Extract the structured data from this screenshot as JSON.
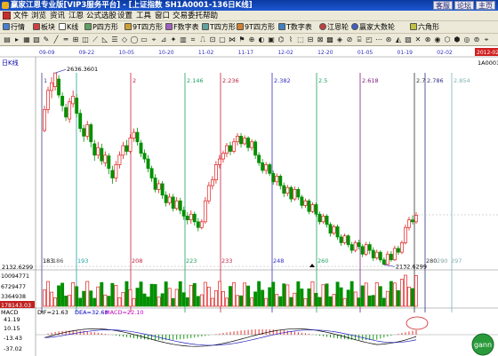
{
  "window": {
    "title": "赢家江恩专业版[VIP3服务平台] - [上证指数  SH1A0001-136日K线]",
    "buttons": [
      "客服",
      "论坛",
      "主页"
    ]
  },
  "menu": [
    "文件",
    "浏览",
    "资讯",
    "江恩",
    "公式选股",
    "设置",
    "工具",
    "窗口",
    "交易委托",
    "帮助"
  ],
  "toolbar1": [
    "行情",
    "板块",
    "K线",
    "P四方形",
    "9T四方形",
    "F数字表",
    "T四方形",
    "9T四方形",
    "T数字表",
    "江恩轮",
    "赢家大数轮",
    "六角形"
  ],
  "chart": {
    "period_label": "日K线",
    "date_ticks": [
      "09-09",
      "09-22",
      "10-05",
      "10-20",
      "11-02",
      "11-17",
      "12-02",
      "12-20",
      "01-05",
      "01-19",
      "02-02",
      "2012-02"
    ],
    "top_right_code": "1A0001",
    "price_top": "2636.3601",
    "price_low": "2132.6299",
    "price_left_low": "2132.6299",
    "cycle_labels": [
      "1",
      "2",
      "2.146",
      "2.236",
      "2.382",
      "2.5",
      "2.618",
      "2.786",
      "2.854",
      "2.7"
    ],
    "bottom_labels": [
      "183",
      "186",
      "193",
      "208",
      "223",
      "233",
      "248",
      "260",
      "280",
      "290",
      "297",
      "27"
    ],
    "volume_labels": [
      "10094771",
      "6729477",
      "3364938",
      "178143.03"
    ],
    "macd_header": {
      "name": "MACD",
      "dif": "DIF=21.63",
      "dea": "DEA=32.68",
      "macd": "MACD=22.10"
    },
    "macd_axis": [
      "41.19",
      "10.15",
      "-13.43",
      "-37.02"
    ],
    "logo_text": "gann"
  },
  "chart_data": {
    "type": "candlestick",
    "title": "上证指数  SH1A0001-136日K线",
    "ylim": [
      2132.6299,
      2636.3601
    ],
    "bars": [
      [
        2485,
        2540,
        2480,
        2550
      ],
      [
        2540,
        2590,
        2530,
        2600
      ],
      [
        2590,
        2610,
        2570,
        2625
      ],
      [
        2600,
        2636,
        2590,
        2636
      ],
      [
        2620,
        2578,
        2570,
        2630
      ],
      [
        2575,
        2550,
        2535,
        2585
      ],
      [
        2545,
        2520,
        2510,
        2555
      ],
      [
        2515,
        2560,
        2505,
        2570
      ],
      [
        2555,
        2575,
        2545,
        2590
      ],
      [
        2570,
        2530,
        2520,
        2580
      ],
      [
        2530,
        2490,
        2480,
        2540
      ],
      [
        2490,
        2470,
        2455,
        2500
      ],
      [
        2470,
        2500,
        2460,
        2510
      ],
      [
        2500,
        2455,
        2440,
        2505
      ],
      [
        2450,
        2420,
        2405,
        2460
      ],
      [
        2420,
        2440,
        2410,
        2455
      ],
      [
        2438,
        2405,
        2395,
        2450
      ],
      [
        2400,
        2420,
        2390,
        2430
      ],
      [
        2418,
        2385,
        2370,
        2425
      ],
      [
        2380,
        2360,
        2345,
        2392
      ],
      [
        2360,
        2395,
        2350,
        2405
      ],
      [
        2395,
        2420,
        2385,
        2430
      ],
      [
        2420,
        2445,
        2410,
        2455
      ],
      [
        2445,
        2430,
        2420,
        2460
      ],
      [
        2430,
        2465,
        2425,
        2475
      ],
      [
        2465,
        2480,
        2455,
        2490
      ],
      [
        2480,
        2455,
        2445,
        2492
      ],
      [
        2452,
        2425,
        2415,
        2460
      ],
      [
        2425,
        2410,
        2400,
        2435
      ],
      [
        2410,
        2385,
        2375,
        2420
      ],
      [
        2385,
        2360,
        2350,
        2392
      ],
      [
        2360,
        2330,
        2322,
        2370
      ],
      [
        2330,
        2345,
        2320,
        2355
      ],
      [
        2345,
        2315,
        2305,
        2352
      ],
      [
        2315,
        2295,
        2285,
        2325
      ],
      [
        2295,
        2310,
        2288,
        2320
      ],
      [
        2310,
        2280,
        2272,
        2318
      ],
      [
        2280,
        2300,
        2275,
        2310
      ],
      [
        2300,
        2275,
        2265,
        2308
      ],
      [
        2275,
        2260,
        2250,
        2285
      ],
      [
        2260,
        2250,
        2238,
        2270
      ],
      [
        2250,
        2265,
        2240,
        2275
      ],
      [
        2265,
        2245,
        2235,
        2272
      ],
      [
        2245,
        2230,
        2220,
        2255
      ],
      [
        2230,
        2245,
        2225,
        2252
      ],
      [
        2245,
        2300,
        2240,
        2310
      ],
      [
        2300,
        2340,
        2292,
        2350
      ],
      [
        2340,
        2355,
        2330,
        2365
      ],
      [
        2355,
        2395,
        2345,
        2405
      ],
      [
        2395,
        2410,
        2385,
        2420
      ],
      [
        2410,
        2425,
        2400,
        2432
      ],
      [
        2425,
        2445,
        2415,
        2452
      ],
      [
        2445,
        2430,
        2420,
        2455
      ],
      [
        2430,
        2455,
        2425,
        2465
      ],
      [
        2455,
        2470,
        2445,
        2478
      ],
      [
        2470,
        2450,
        2440,
        2478
      ],
      [
        2450,
        2465,
        2445,
        2472
      ],
      [
        2465,
        2440,
        2430,
        2470
      ],
      [
        2440,
        2455,
        2432,
        2462
      ],
      [
        2455,
        2420,
        2410,
        2460
      ],
      [
        2420,
        2400,
        2392,
        2428
      ],
      [
        2400,
        2380,
        2372,
        2410
      ],
      [
        2380,
        2395,
        2370,
        2402
      ],
      [
        2395,
        2372,
        2365,
        2400
      ],
      [
        2372,
        2350,
        2342,
        2380
      ],
      [
        2350,
        2365,
        2340,
        2372
      ],
      [
        2365,
        2340,
        2330,
        2370
      ],
      [
        2340,
        2320,
        2310,
        2348
      ],
      [
        2320,
        2335,
        2312,
        2342
      ],
      [
        2335,
        2305,
        2296,
        2340
      ],
      [
        2305,
        2330,
        2300,
        2338
      ],
      [
        2330,
        2310,
        2302,
        2336
      ],
      [
        2310,
        2288,
        2280,
        2316
      ],
      [
        2288,
        2300,
        2282,
        2306
      ],
      [
        2300,
        2272,
        2265,
        2305
      ],
      [
        2272,
        2290,
        2268,
        2296
      ],
      [
        2290,
        2265,
        2258,
        2296
      ],
      [
        2265,
        2245,
        2238,
        2272
      ],
      [
        2245,
        2260,
        2240,
        2266
      ],
      [
        2260,
        2238,
        2230,
        2265
      ],
      [
        2238,
        2215,
        2206,
        2244
      ],
      [
        2215,
        2232,
        2210,
        2238
      ],
      [
        2232,
        2205,
        2198,
        2238
      ],
      [
        2205,
        2190,
        2182,
        2212
      ],
      [
        2190,
        2208,
        2185,
        2214
      ],
      [
        2208,
        2185,
        2178,
        2212
      ],
      [
        2185,
        2170,
        2162,
        2192
      ],
      [
        2170,
        2190,
        2165,
        2196
      ],
      [
        2190,
        2180,
        2172,
        2198
      ],
      [
        2180,
        2160,
        2152,
        2186
      ],
      [
        2160,
        2185,
        2155,
        2192
      ],
      [
        2185,
        2170,
        2160,
        2192
      ],
      [
        2170,
        2150,
        2142,
        2178
      ],
      [
        2150,
        2165,
        2145,
        2172
      ],
      [
        2165,
        2145,
        2138,
        2170
      ],
      [
        2145,
        2133,
        2132,
        2152
      ],
      [
        2133,
        2160,
        2132,
        2168
      ],
      [
        2160,
        2145,
        2140,
        2168
      ],
      [
        2145,
        2175,
        2142,
        2182
      ],
      [
        2175,
        2165,
        2158,
        2182
      ],
      [
        2165,
        2190,
        2160,
        2196
      ],
      [
        2190,
        2230,
        2185,
        2238
      ],
      [
        2230,
        2250,
        2222,
        2258
      ],
      [
        2250,
        2245,
        2238,
        2262
      ],
      [
        2245,
        2262,
        2240,
        2270
      ]
    ]
  }
}
